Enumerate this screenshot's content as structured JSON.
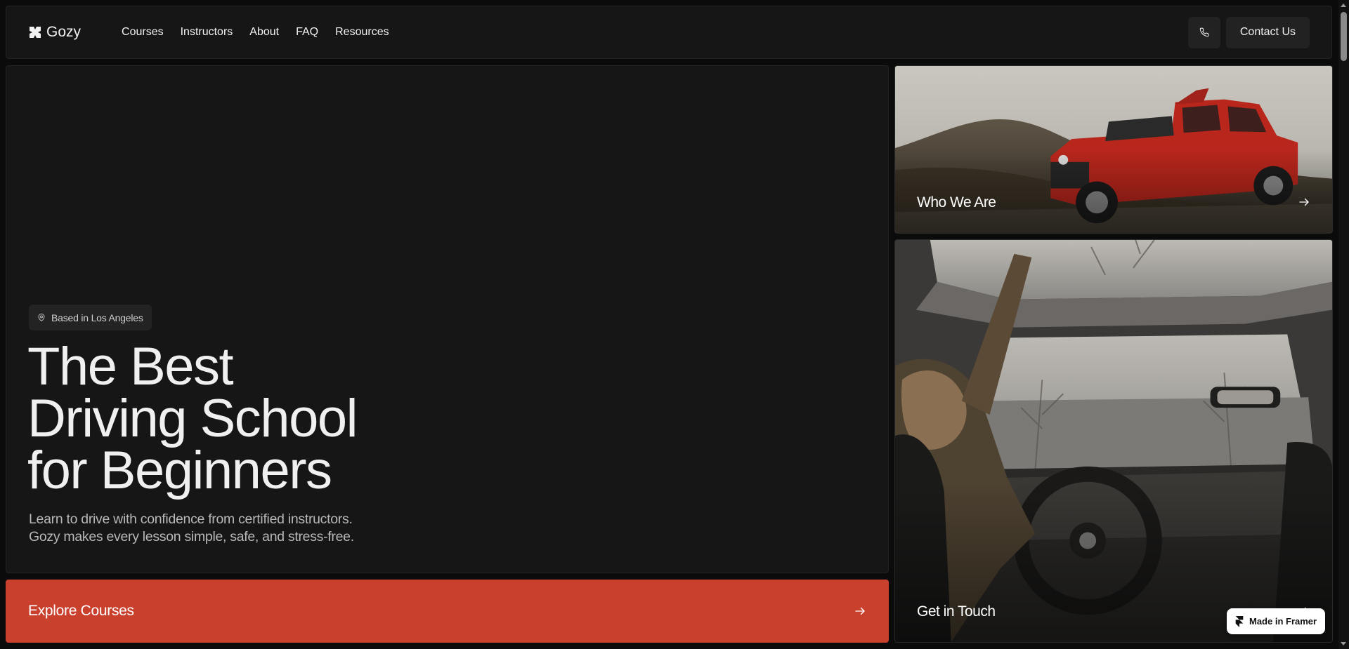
{
  "nav": {
    "brand": "Gozy",
    "links": [
      "Courses",
      "Instructors",
      "About",
      "FAQ",
      "Resources"
    ],
    "contact_label": "Contact Us",
    "phone_icon": "phone-icon"
  },
  "hero": {
    "location": "Based in Los Angeles",
    "location_icon": "map-pin-icon",
    "title_lines": [
      "The Best",
      "Driving School",
      "for Beginners"
    ],
    "subtitle_lines": [
      "Learn to drive with confidence from certified instructors.",
      "Gozy makes every lesson simple, safe, and stress-free."
    ]
  },
  "cta": {
    "label": "Explore Courses",
    "icon": "arrow-right-icon",
    "color": "#c9412d"
  },
  "cards": [
    {
      "label": "Who We Are",
      "icon": "arrow-right-icon",
      "image": "red-jeep-on-hillside"
    },
    {
      "label": "Get in Touch",
      "icon": "arrow-right-icon",
      "image": "woman-driving-car-interior"
    }
  ],
  "framer_badge": {
    "label": "Made in Framer"
  },
  "colors": {
    "background": "#0b0b0b",
    "panel": "#161616",
    "accent": "#c9412d"
  }
}
